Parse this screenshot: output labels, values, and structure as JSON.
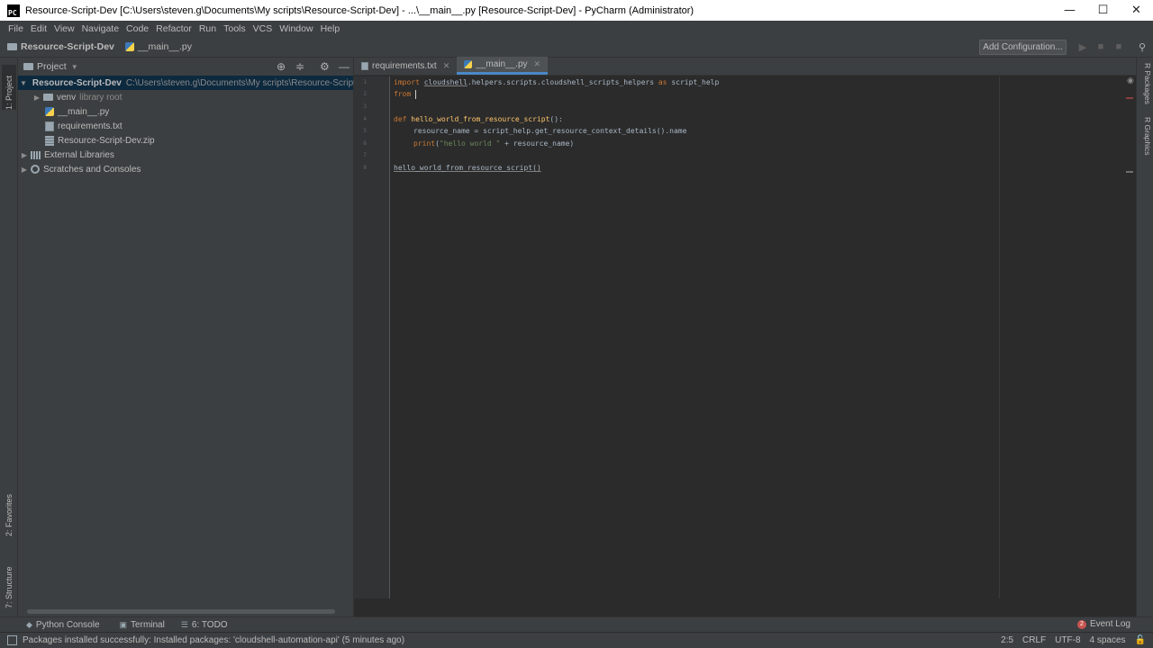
{
  "window": {
    "title": "Resource-Script-Dev [C:\\Users\\steven.g\\Documents\\My scripts\\Resource-Script-Dev] - ...\\__main__.py [Resource-Script-Dev] - PyCharm (Administrator)",
    "app_icon": "PC",
    "minimize": "—",
    "maximize": "☐",
    "close": "✕"
  },
  "menu": [
    "File",
    "Edit",
    "View",
    "Navigate",
    "Code",
    "Refactor",
    "Run",
    "Tools",
    "VCS",
    "Window",
    "Help"
  ],
  "navbar": {
    "project": "Resource-Script-Dev",
    "file": "__main__.py",
    "add_configuration": "Add Configuration..."
  },
  "left_tabs": {
    "project": "1: Project",
    "favorites": "2: Favorites",
    "structure": "7: Structure"
  },
  "right_tabs": {
    "packages": "R Packages",
    "graphics": "R Graphics"
  },
  "project_panel": {
    "title": "Project",
    "tree": [
      {
        "label": "Resource-Script-Dev",
        "path": "C:\\Users\\steven.g\\Documents\\My scripts\\Resource-Script",
        "icon": "folder-icon"
      },
      {
        "label": "venv",
        "note": "library root",
        "icon": "folder-icon"
      },
      {
        "label": "__main__.py",
        "icon": "python-file-icon"
      },
      {
        "label": "requirements.txt",
        "icon": "text-file-icon"
      },
      {
        "label": "Resource-Script-Dev.zip",
        "icon": "zip-file-icon"
      },
      {
        "label": "External Libraries",
        "icon": "library-icon"
      },
      {
        "label": "Scratches and Consoles",
        "icon": "scratch-icon"
      }
    ]
  },
  "editor": {
    "tabs": [
      {
        "label": "requirements.txt",
        "active": false
      },
      {
        "label": "__main__.py",
        "active": true
      }
    ],
    "line_numbers": [
      "1",
      "2",
      "3",
      "4",
      "5",
      "6",
      "7",
      "8"
    ],
    "code": {
      "l1_import": "import",
      "l1_module": "cloudshell",
      "l1_rest": ".helpers.scripts.cloudshell_scripts_helpers",
      "l1_as": "as",
      "l1_alias": "script_help",
      "l2_from": "from",
      "l4_def": "def",
      "l4_name": "hello_world_from_resource_script",
      "l4_paren": "():",
      "l5": "resource_name = script_help.get_resource_context_details().name",
      "l6_print": "print",
      "l6_open": "(",
      "l6_str": "\"hello world \"",
      "l6_rest": " + resource_name)",
      "l8": "hello_world_from_resource_script()"
    }
  },
  "bottom_tools": [
    "Python Console",
    "Terminal",
    "6: TODO"
  ],
  "event_log": {
    "count": "2",
    "label": "Event Log"
  },
  "status": {
    "message": "Packages installed successfully: Installed packages: 'cloudshell-automation-api' (5 minutes ago)",
    "position": "2:5",
    "line_sep": "CRLF",
    "encoding": "UTF-8",
    "indent": "4 spaces"
  }
}
